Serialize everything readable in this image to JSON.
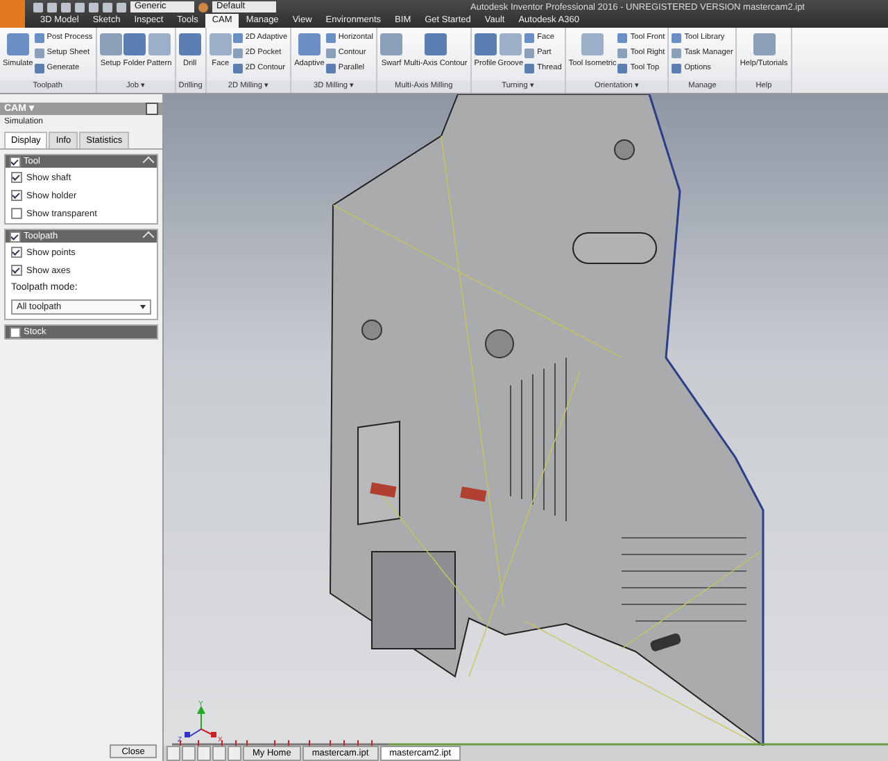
{
  "window": {
    "title": "Autodesk Inventor Professional 2016 - UNREGISTERED VERSION   mastercam2.ipt"
  },
  "quick_access": {
    "style_dropdown": "Generic",
    "appearance_dropdown": "Default"
  },
  "ribbon_tabs": [
    {
      "label": "3D Model",
      "selected": false
    },
    {
      "label": "Sketch",
      "selected": false
    },
    {
      "label": "Inspect",
      "selected": false
    },
    {
      "label": "Tools",
      "selected": false
    },
    {
      "label": "CAM",
      "selected": true
    },
    {
      "label": "Manage",
      "selected": false
    },
    {
      "label": "View",
      "selected": false
    },
    {
      "label": "Environments",
      "selected": false
    },
    {
      "label": "BIM",
      "selected": false
    },
    {
      "label": "Get Started",
      "selected": false
    },
    {
      "label": "Vault",
      "selected": false
    },
    {
      "label": "Autodesk A360",
      "selected": false
    }
  ],
  "ribbon_groups": [
    {
      "label": "Toolpath",
      "items": [
        {
          "kind": "large",
          "label": "Simulate"
        },
        {
          "kind": "stack",
          "labels": [
            "Post Process",
            "Setup Sheet",
            "Generate"
          ]
        }
      ]
    },
    {
      "label": "Job ▾",
      "items": [
        {
          "kind": "large",
          "label": "Setup"
        },
        {
          "kind": "large",
          "label": "Folder"
        },
        {
          "kind": "large",
          "label": "Pattern"
        }
      ]
    },
    {
      "label": "Drilling",
      "items": [
        {
          "kind": "large",
          "label": "Drill"
        }
      ]
    },
    {
      "label": "2D Milling ▾",
      "items": [
        {
          "kind": "large",
          "label": "Face"
        },
        {
          "kind": "stack",
          "labels": [
            "2D Adaptive",
            "2D Pocket",
            "2D Contour"
          ]
        }
      ]
    },
    {
      "label": "3D Milling ▾",
      "items": [
        {
          "kind": "large",
          "label": "Adaptive"
        },
        {
          "kind": "stack",
          "labels": [
            "Horizontal",
            "Contour",
            "Parallel"
          ]
        }
      ]
    },
    {
      "label": "Multi-Axis Milling",
      "items": [
        {
          "kind": "large",
          "label": "Swarf"
        },
        {
          "kind": "large",
          "label": "Multi-Axis Contour"
        }
      ]
    },
    {
      "label": "Turning ▾",
      "items": [
        {
          "kind": "large",
          "label": "Profile"
        },
        {
          "kind": "large",
          "label": "Groove"
        },
        {
          "kind": "stack",
          "labels": [
            "Face",
            "Part",
            "Thread"
          ]
        }
      ]
    },
    {
      "label": "Orientation ▾",
      "items": [
        {
          "kind": "large",
          "label": "Tool Isometric"
        },
        {
          "kind": "stack",
          "labels": [
            "Tool Front",
            "Tool Right",
            "Tool Top"
          ]
        }
      ]
    },
    {
      "label": "Manage",
      "items": [
        {
          "kind": "stack",
          "labels": [
            "Tool Library",
            "Task Manager",
            "Options"
          ]
        }
      ]
    },
    {
      "label": "Help",
      "items": [
        {
          "kind": "large",
          "label": "Help/Tutorials"
        }
      ]
    }
  ],
  "panel": {
    "title": "CAM ▾",
    "subtitle": "Simulation",
    "tabs": [
      {
        "label": "Display",
        "selected": true
      },
      {
        "label": "Info",
        "selected": false
      },
      {
        "label": "Statistics",
        "selected": false
      }
    ],
    "sections": [
      {
        "title": "Tool",
        "checked": true,
        "expanded": true,
        "options": [
          {
            "label": "Show shaft",
            "checked": true
          },
          {
            "label": "Show holder",
            "checked": true
          },
          {
            "label": "Show transparent",
            "checked": false
          }
        ]
      },
      {
        "title": "Toolpath",
        "checked": true,
        "expanded": true,
        "options": [
          {
            "label": "Show points",
            "checked": true
          },
          {
            "label": "Show axes",
            "checked": true
          }
        ],
        "mode_label": "Toolpath mode:",
        "mode_value": "All toolpath"
      },
      {
        "title": "Stock",
        "checked": false,
        "expanded": false
      }
    ],
    "close_button": "Close"
  },
  "viewport": {
    "triad": {
      "x": "X",
      "y": "Y",
      "z": "Z"
    }
  },
  "document_tabs": [
    {
      "label": "My Home",
      "selected": false
    },
    {
      "label": "mastercam.ipt",
      "selected": false
    },
    {
      "label": "mastercam2.ipt",
      "selected": true
    }
  ]
}
